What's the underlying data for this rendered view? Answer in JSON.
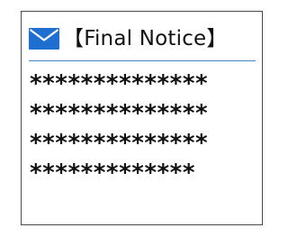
{
  "notice": {
    "icon": "envelope-icon",
    "accent_color": "#1f6fd1",
    "divider_color": "#3f86c7",
    "title": "【Final Notice】",
    "masked_lines": [
      "**************",
      "**************",
      "**************",
      "*************"
    ]
  }
}
